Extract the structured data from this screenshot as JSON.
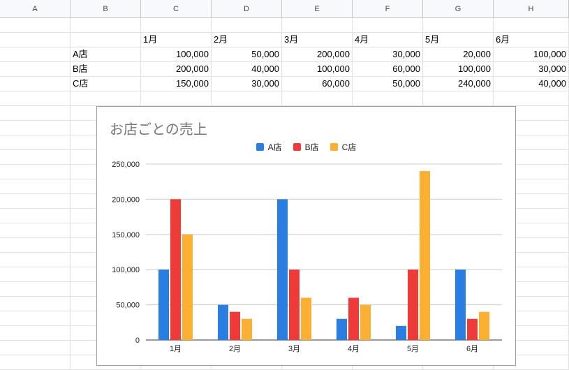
{
  "columns": [
    "A",
    "B",
    "C",
    "D",
    "E",
    "F",
    "G",
    "H"
  ],
  "table": {
    "header": [
      "",
      "1月",
      "2月",
      "3月",
      "4月",
      "5月",
      "6月"
    ],
    "rows": [
      {
        "label": "A店",
        "values": [
          "100,000",
          "50,000",
          "200,000",
          "30,000",
          "20,000",
          "100,000"
        ]
      },
      {
        "label": "B店",
        "values": [
          "200,000",
          "40,000",
          "100,000",
          "60,000",
          "100,000",
          "30,000"
        ]
      },
      {
        "label": "C店",
        "values": [
          "150,000",
          "30,000",
          "60,000",
          "50,000",
          "240,000",
          "40,000"
        ]
      }
    ]
  },
  "chart_data": {
    "type": "bar",
    "title": "お店ごとの売上",
    "categories": [
      "1月",
      "2月",
      "3月",
      "4月",
      "5月",
      "6月"
    ],
    "series": [
      {
        "name": "A店",
        "color": "#2a7de1",
        "values": [
          100000,
          50000,
          200000,
          30000,
          20000,
          100000
        ]
      },
      {
        "name": "B店",
        "color": "#ef3a3a",
        "values": [
          200000,
          40000,
          100000,
          60000,
          100000,
          30000
        ]
      },
      {
        "name": "C店",
        "color": "#fbb033",
        "values": [
          150000,
          30000,
          60000,
          50000,
          240000,
          40000
        ]
      }
    ],
    "ylim": [
      0,
      250000
    ],
    "yticks": [
      "0",
      "50,000",
      "100,000",
      "150,000",
      "200,000",
      "250,000"
    ],
    "legend": "top",
    "grid": true
  }
}
